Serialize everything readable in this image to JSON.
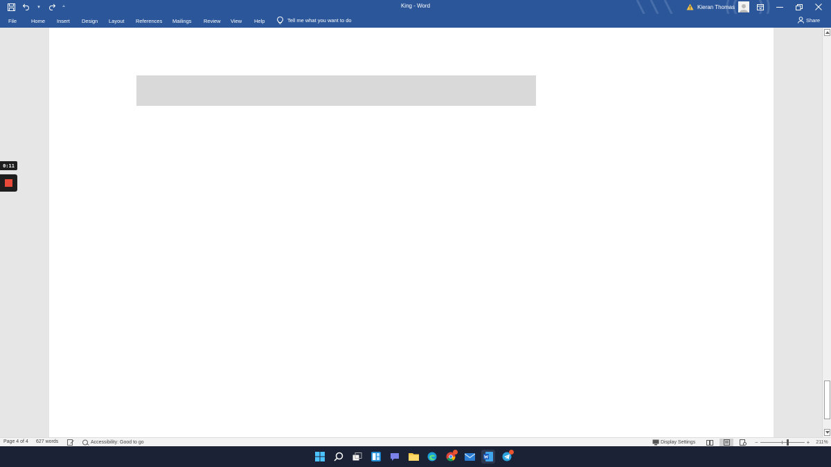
{
  "window": {
    "title": "King  -  Word",
    "user_name": "Kieran Thomas"
  },
  "icons": {
    "save": "save-icon",
    "undo": "undo-icon",
    "redo": "redo-icon",
    "customize": "customize-qat-icon",
    "warning": "warning-icon",
    "avatar": "user-avatar-icon",
    "ribbon_display": "ribbon-display-options-icon",
    "minimize": "minimize-icon",
    "restore": "restore-icon",
    "close": "close-icon",
    "lightbulb": "lightbulb-icon",
    "share": "person-share-icon"
  },
  "menu": {
    "items": [
      "File",
      "Home",
      "Insert",
      "Design",
      "Layout",
      "References",
      "Mailings",
      "Review",
      "View",
      "Help"
    ],
    "tell_me": "Tell me what you want to do",
    "share": "Share"
  },
  "recording": {
    "elapsed": "0:11"
  },
  "status": {
    "page": "Page 4 of 4",
    "words": "627 words",
    "accessibility": "Accessibility: Good to go",
    "display_settings": "Display Settings",
    "zoom_minus": "−",
    "zoom_plus": "+",
    "zoom": "211%"
  },
  "taskbar": {
    "apps": [
      "start",
      "search",
      "task-view",
      "widgets",
      "teams-chat",
      "file-explorer",
      "edge",
      "chrome",
      "mail",
      "word",
      "telegram"
    ]
  },
  "colors": {
    "ribbon": "#2b579a",
    "taskbar": "#1b2235",
    "record": "#e84a3a"
  }
}
